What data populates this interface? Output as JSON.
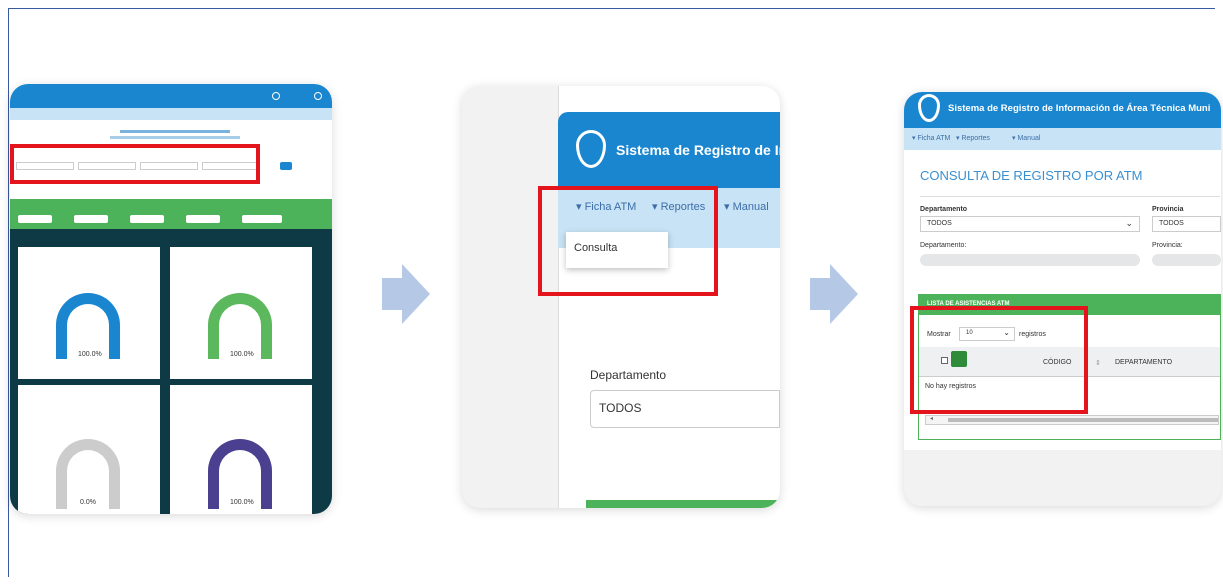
{
  "card2": {
    "system_title": "Sistema de Registro de Informac",
    "menu": {
      "ficha": "▾ Ficha ATM",
      "reportes": "▾ Reportes",
      "manual": "▾ Manual"
    },
    "dropdown_item": "Consulta",
    "field_label": "Departamento",
    "field_value": "TODOS"
  },
  "card3": {
    "system_title": "Sistema de Registro de Información de Área Técnica Muni",
    "menu": {
      "ficha": "▾ Ficha ATM",
      "reportes": "▾ Reportes",
      "manual": "▾ Manual"
    },
    "page_title": "CONSULTA DE REGISTRO POR ATM",
    "departamento_label": "Departamento",
    "departamento_value": "TODOS",
    "provincia_label": "Provincia",
    "provincia_value": "TODOS",
    "departamento_label2": "Departamento:",
    "provincia_label2": "Provincia:",
    "list_title": "LISTA DE ASISTENCIAS ATM",
    "mostrar": "Mostrar",
    "mostrar_value": "10",
    "registros": "registros",
    "col_codigo": "CÓDIGO",
    "col_departamento": "DEPARTAMENTO",
    "no_records": "No hay registros"
  },
  "card1": {
    "gauges": [
      {
        "value": "100.0%",
        "color": "#1a86d0",
        "fill": 1.0
      },
      {
        "value": "100.0%",
        "color": "#5cb85c",
        "fill": 1.0
      },
      {
        "value": "0.0%",
        "color": "#cccccc",
        "fill": 0.0
      },
      {
        "value": "100.0%",
        "color": "#4b3f8f",
        "fill": 1.0
      }
    ]
  },
  "colors": {
    "highlight": "#e3141b",
    "arrow": "#b5c8e6",
    "brand": "#1a86d0",
    "green": "#4db35a"
  }
}
